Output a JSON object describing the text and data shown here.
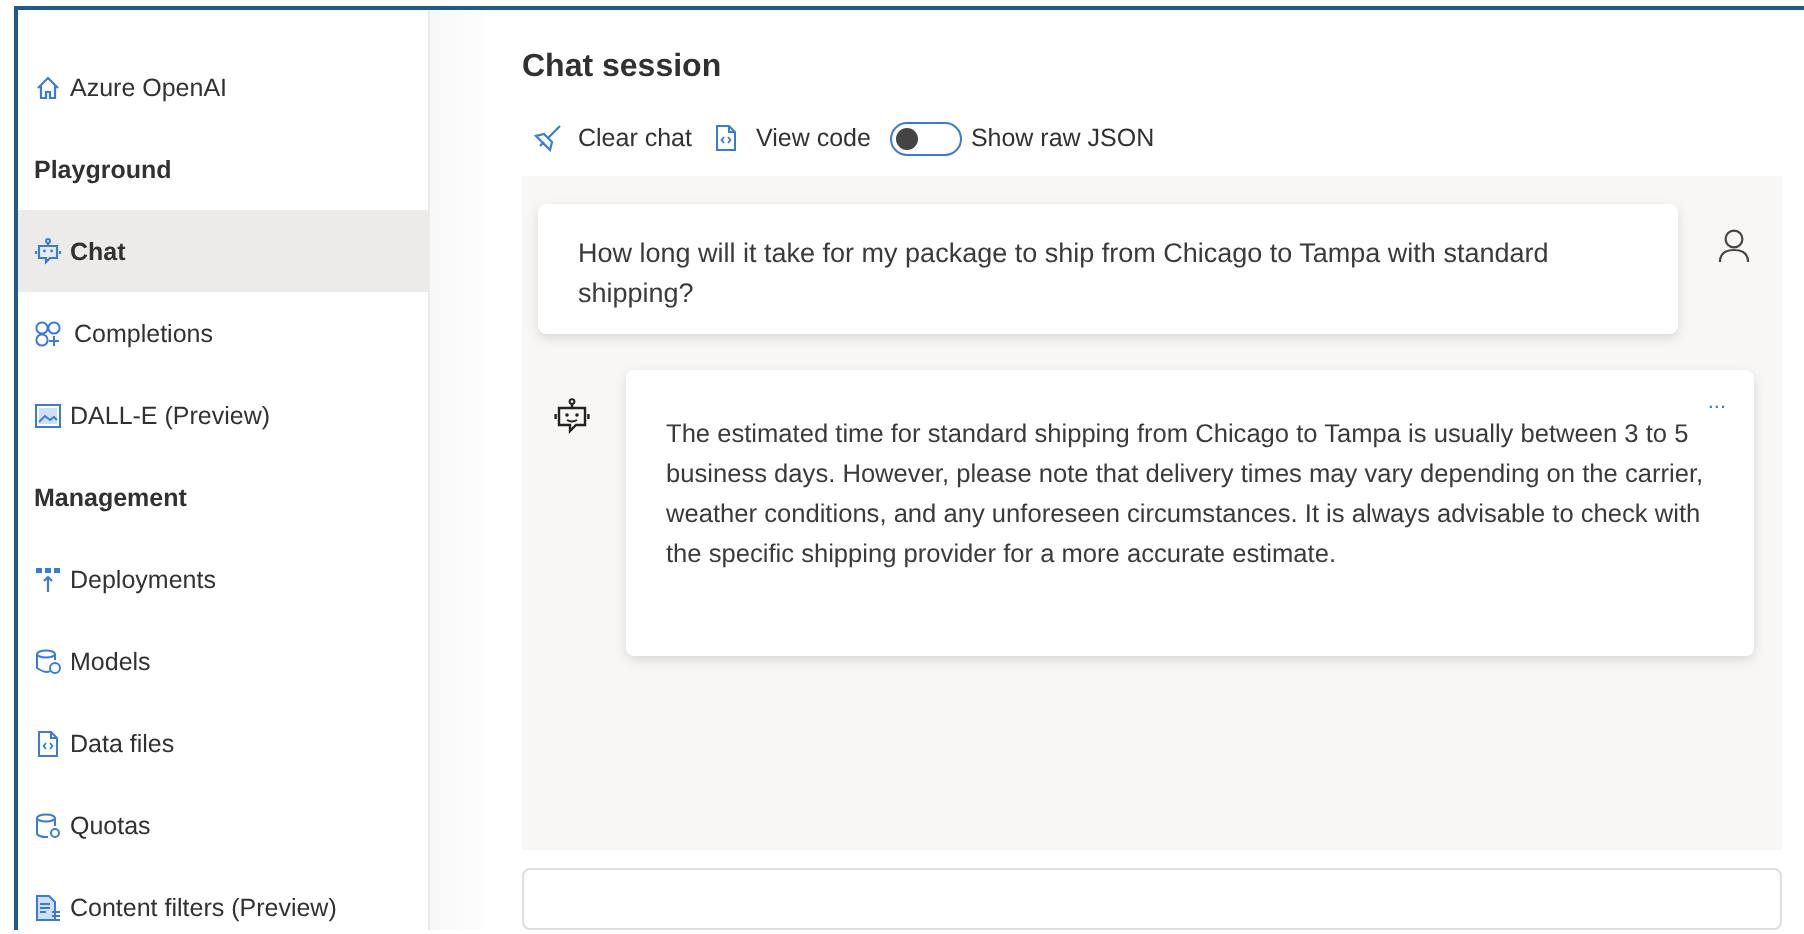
{
  "sidebar": {
    "items": [
      {
        "kind": "link",
        "label": "Azure OpenAI",
        "selected": false
      },
      {
        "kind": "header",
        "label": "Playground"
      },
      {
        "kind": "link",
        "label": "Chat",
        "selected": true
      },
      {
        "kind": "link",
        "label": "Completions",
        "selected": false
      },
      {
        "kind": "link",
        "label": "DALL-E (Preview)",
        "selected": false
      },
      {
        "kind": "header",
        "label": "Management"
      },
      {
        "kind": "link",
        "label": "Deployments",
        "selected": false
      },
      {
        "kind": "link",
        "label": "Models",
        "selected": false
      },
      {
        "kind": "link",
        "label": "Data files",
        "selected": false
      },
      {
        "kind": "link",
        "label": "Quotas",
        "selected": false
      },
      {
        "kind": "link",
        "label": "Content filters (Preview)",
        "selected": false
      }
    ]
  },
  "main": {
    "title": "Chat session",
    "toolbar": {
      "clear": "Clear chat",
      "view_code": "View code",
      "toggle": {
        "label": "Show raw JSON",
        "on": false
      }
    },
    "messages": [
      {
        "kind": "user",
        "text": "How long will it take for my package to ship from Chicago to Tampa with standard shipping?"
      },
      {
        "kind": "assistant",
        "more": "...",
        "text": "The estimated time for standard shipping from Chicago to Tampa is usually between 3 to 5 business days. However, please note that delivery times may vary depending on the carrier, weather conditions, and any unforeseen circumstances. It is always advisable to check with the specific shipping provider for a more accurate estimate."
      }
    ]
  }
}
